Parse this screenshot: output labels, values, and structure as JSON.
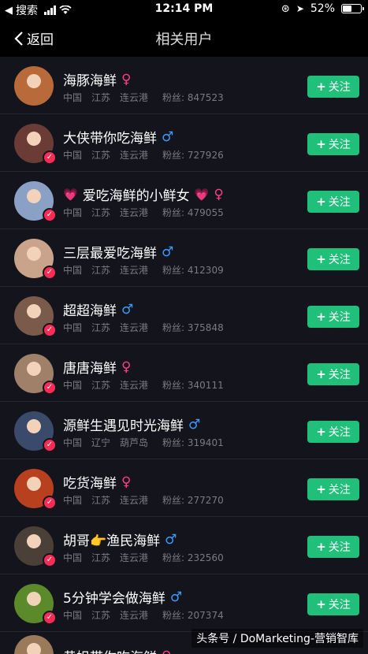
{
  "status_bar": {
    "left_label": "搜索",
    "time": "12:14 PM",
    "battery_text": "52%",
    "battery_level": 0.52
  },
  "nav": {
    "back_label": "返回",
    "title": "相关用户"
  },
  "follow_label": "关注",
  "users": [
    {
      "name": "海豚海鲜",
      "gender": "female",
      "verified": false,
      "region": [
        "中国",
        "江苏",
        "连云港"
      ],
      "fans": "粉丝: 847523",
      "avatar_color": "#b86a3a"
    },
    {
      "name": "大侠带你吃海鲜",
      "gender": "male",
      "verified": true,
      "region": [
        "中国",
        "江苏",
        "连云港"
      ],
      "fans": "粉丝: 727926",
      "avatar_color": "#6b3b36"
    },
    {
      "name": "爱吃海鲜的小鲜女",
      "gender": "female",
      "verified": true,
      "hearts": true,
      "region": [
        "中国",
        "江苏",
        "连云港"
      ],
      "fans": "粉丝: 479055",
      "avatar_color": "#8aa0c4"
    },
    {
      "name": "三层最爱吃海鲜",
      "gender": "male",
      "verified": true,
      "region": [
        "中国",
        "江苏",
        "连云港"
      ],
      "fans": "粉丝: 412309",
      "avatar_color": "#c9a48a"
    },
    {
      "name": "超超海鲜",
      "gender": "male",
      "verified": true,
      "region": [
        "中国",
        "江苏",
        "连云港"
      ],
      "fans": "粉丝: 375848",
      "avatar_color": "#7a5a4a"
    },
    {
      "name": "唐唐海鲜",
      "gender": "female",
      "verified": true,
      "region": [
        "中国",
        "江苏",
        "连云港"
      ],
      "fans": "粉丝: 340111",
      "avatar_color": "#a08068"
    },
    {
      "name": "源鲜生遇见时光海鲜",
      "gender": "male",
      "verified": true,
      "region": [
        "中国",
        "辽宁",
        "葫芦岛"
      ],
      "fans": "粉丝: 319401",
      "avatar_color": "#3a4a6a"
    },
    {
      "name": "吃货海鲜",
      "gender": "female",
      "verified": true,
      "region": [
        "中国",
        "江苏",
        "连云港"
      ],
      "fans": "粉丝: 277270",
      "avatar_color": "#b8401e"
    },
    {
      "name": "胡哥👉渔民海鲜",
      "gender": "male",
      "verified": true,
      "region": [
        "中国",
        "江苏",
        "连云港"
      ],
      "fans": "粉丝: 232560",
      "avatar_color": "#4a4038"
    },
    {
      "name": "5分钟学会做海鲜",
      "gender": "male",
      "verified": true,
      "region": [
        "中国",
        "江苏",
        "连云港"
      ],
      "fans": "粉丝: 207374",
      "avatar_color": "#5a8a2a"
    }
  ],
  "partial_user": {
    "name": "黄姐带你吃海鲜",
    "gender": "female",
    "avatar_color": "#9a7a5a"
  },
  "watermark": "头条号 / DoMarketing-营销智库",
  "colors": {
    "accent_green": "#20c07a",
    "female": "#ff3b8c",
    "male": "#3a9bff",
    "verified": "#fe2c55"
  }
}
